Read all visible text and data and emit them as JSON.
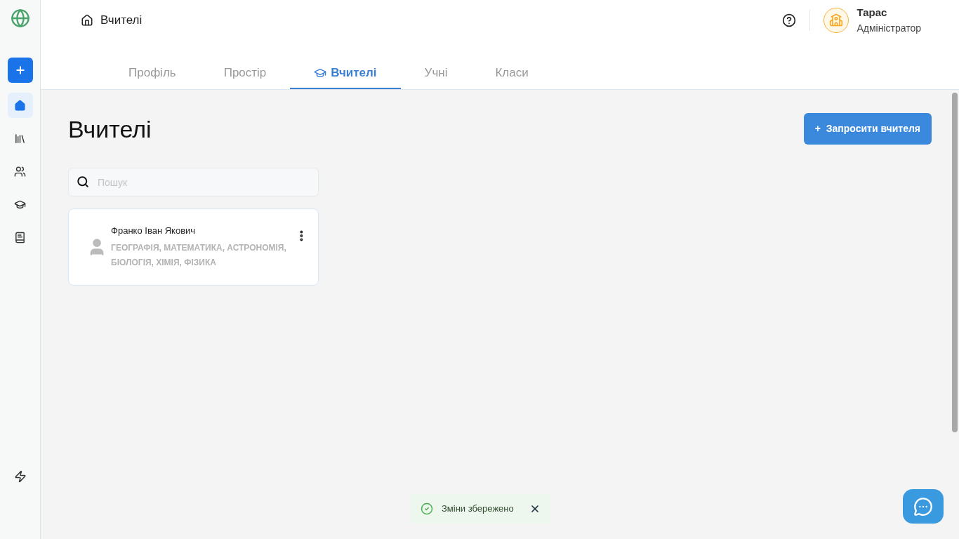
{
  "sidebar": {
    "items": [
      {
        "kind": "home",
        "selected": true
      },
      {
        "kind": "library",
        "selected": false
      },
      {
        "kind": "users",
        "selected": false
      },
      {
        "kind": "cap",
        "selected": false
      },
      {
        "kind": "journal",
        "selected": false
      }
    ]
  },
  "breadcrumb": "Вчителі",
  "user": {
    "name": "Тарас",
    "role": "Адміністратор"
  },
  "tabs": [
    {
      "label": "Профіль",
      "selected": false
    },
    {
      "label": "Простір",
      "selected": false
    },
    {
      "label": "Вчителі",
      "selected": true
    },
    {
      "label": "Учні",
      "selected": false
    },
    {
      "label": "Класи",
      "selected": false
    }
  ],
  "page_title": "Вчителі",
  "invite_button": "+  Запросити вчителя",
  "search": {
    "placeholder": "Пошук"
  },
  "teachers": [
    {
      "name": "Франко Іван Якович",
      "subjects": "ГЕОГРАФІЯ, МАТЕМАТИКА, АСТРОНОМІЯ, БІОЛОГІЯ, ХІМІЯ, ФІЗИКА"
    }
  ],
  "toast": {
    "text": "Зміни збережено"
  }
}
